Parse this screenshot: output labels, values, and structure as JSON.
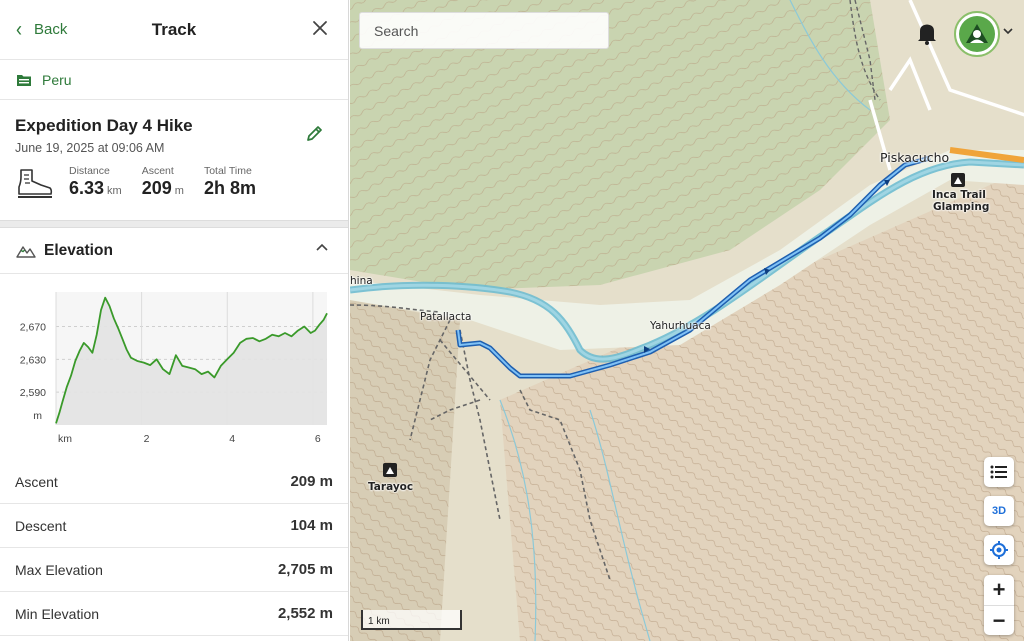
{
  "header": {
    "back_label": "Back",
    "title": "Track"
  },
  "folder": {
    "label": "Peru"
  },
  "track": {
    "name": "Expedition Day 4 Hike",
    "date": "June 19, 2025 at 09:06 AM",
    "stats": [
      {
        "label": "Distance",
        "value": "6.33",
        "unit": "km"
      },
      {
        "label": "Ascent",
        "value": "209",
        "unit": "m"
      },
      {
        "label": "Total Time",
        "value": "2h 8m",
        "unit": ""
      }
    ]
  },
  "elevation": {
    "section_label": "Elevation",
    "y_unit": "m",
    "x_unit": "km",
    "y_ticks": [
      "2,670",
      "2,630",
      "2,590"
    ],
    "x_ticks": [
      "2",
      "4",
      "6"
    ]
  },
  "chart_data": {
    "type": "line",
    "xlabel": "km",
    "ylabel": "m",
    "xlim": [
      0,
      6.33
    ],
    "ylim": [
      2550,
      2712
    ],
    "x": [
      0,
      0.08,
      0.15,
      0.25,
      0.35,
      0.45,
      0.55,
      0.65,
      0.75,
      0.85,
      0.95,
      1.05,
      1.15,
      1.25,
      1.35,
      1.45,
      1.55,
      1.65,
      1.75,
      1.9,
      2.05,
      2.2,
      2.35,
      2.5,
      2.65,
      2.8,
      2.95,
      3.1,
      3.25,
      3.4,
      3.55,
      3.7,
      3.85,
      4.0,
      4.15,
      4.3,
      4.45,
      4.6,
      4.75,
      4.9,
      5.05,
      5.2,
      5.35,
      5.5,
      5.65,
      5.8,
      5.95,
      6.05,
      6.15,
      6.25,
      6.33
    ],
    "series": [
      {
        "values": [
          2552,
          2565,
          2578,
          2596,
          2610,
          2628,
          2640,
          2650,
          2645,
          2638,
          2660,
          2690,
          2705,
          2695,
          2680,
          2668,
          2655,
          2642,
          2632,
          2628,
          2626,
          2623,
          2630,
          2618,
          2612,
          2635,
          2622,
          2620,
          2618,
          2612,
          2615,
          2608,
          2622,
          2630,
          2638,
          2650,
          2655,
          2656,
          2652,
          2655,
          2660,
          2658,
          2662,
          2658,
          2665,
          2670,
          2662,
          2665,
          2672,
          2678,
          2686
        ]
      }
    ]
  },
  "summary": [
    {
      "label": "Ascent",
      "value": "209 m"
    },
    {
      "label": "Descent",
      "value": "104 m"
    },
    {
      "label": "Max Elevation",
      "value": "2,705 m"
    },
    {
      "label": "Min Elevation",
      "value": "2,552 m"
    }
  ],
  "map": {
    "search_placeholder": "Search",
    "labels": {
      "piskacucho": "Piskacucho",
      "inca_trail": "Inca Trail",
      "glamping": "Glamping",
      "patallacta": "Patallacta",
      "yahurhuaca": "Yahurhuaca",
      "tarayoc": "Tarayoc",
      "china": "hina"
    },
    "btn_3d": "3D",
    "zoom_in": "+",
    "zoom_out": "−",
    "scale": "1 km",
    "colors": {
      "track": "#2f8fe6",
      "river": "#6fbcd0",
      "accent": "#2e7a3a"
    }
  }
}
